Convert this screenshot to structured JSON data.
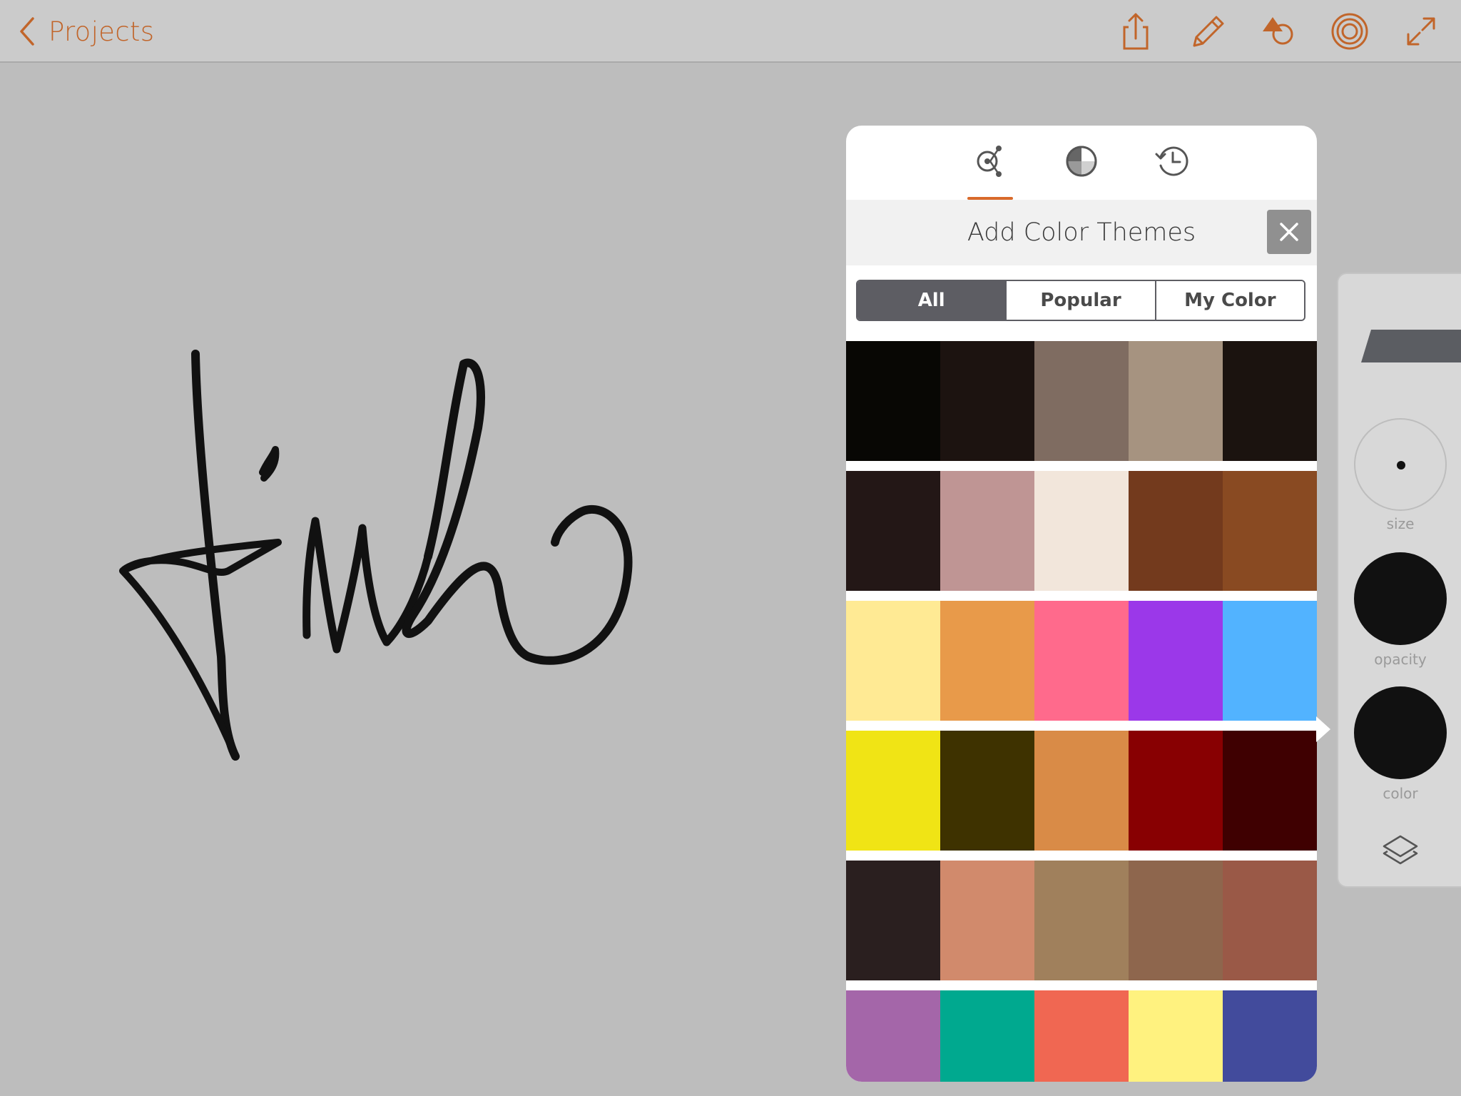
{
  "header": {
    "back_label": "Projects",
    "accent_color": "#c1652a",
    "icons": [
      "share-icon",
      "pencil-icon",
      "shapes-icon",
      "concentric-circles-icon",
      "expand-icon"
    ]
  },
  "panel": {
    "tabs": [
      "color-themes-icon",
      "color-wheel-icon",
      "history-icon"
    ],
    "active_tab": 0,
    "active_tab_color": "#d96a2b",
    "title": "Add Color Themes",
    "filters": [
      "All",
      "Popular",
      "My Color"
    ],
    "active_filter": "All",
    "themes": [
      [
        "#080704",
        "#1c1310",
        "#7f6c61",
        "#a69380",
        "#1b130f"
      ],
      [
        "#231716",
        "#bf9594",
        "#f2e6db",
        "#733a1d",
        "#894a22"
      ],
      [
        "#ffea94",
        "#e89a4a",
        "#ff6a8c",
        "#9b38e9",
        "#52b3ff"
      ],
      [
        "#f0e415",
        "#3e3200",
        "#d98b47",
        "#880002",
        "#3f0001"
      ],
      [
        "#2a1f1f",
        "#d18a6c",
        "#a0805c",
        "#8e664d",
        "#9a5947"
      ],
      [
        "#a466a9",
        "#00a98f",
        "#f06752",
        "#fff27f",
        "#424b9c"
      ]
    ]
  },
  "tools": {
    "size_label": "size",
    "opacity_label": "opacity",
    "color_label": "color",
    "current_color": "#111111"
  }
}
